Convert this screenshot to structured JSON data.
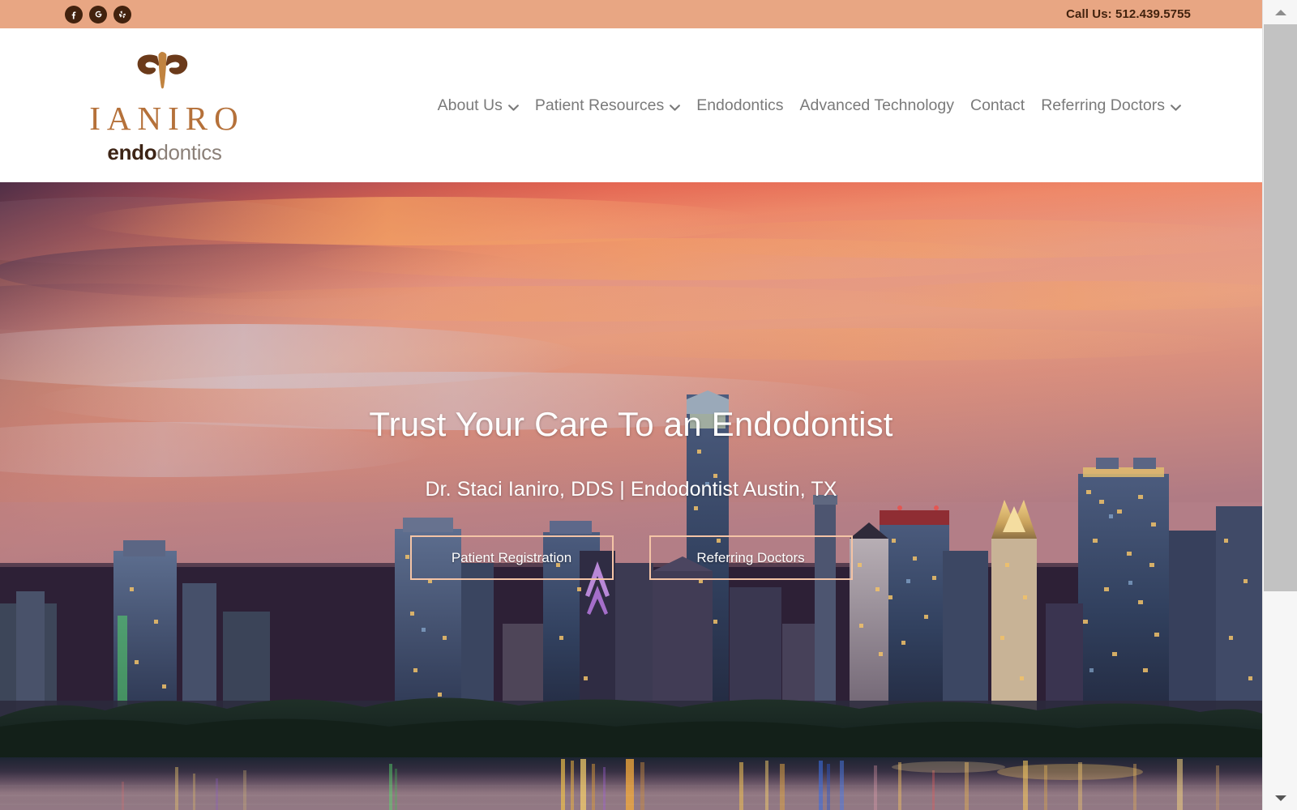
{
  "topbar": {
    "social": [
      {
        "name": "facebook-icon",
        "label": "Facebook"
      },
      {
        "name": "google-icon",
        "label": "Google"
      },
      {
        "name": "yelp-icon",
        "label": "Yelp"
      }
    ],
    "call_us": "Call Us: 512.439.5755",
    "background_color": "#e8a683",
    "icon_color": "#42220e"
  },
  "header": {
    "logo": {
      "wordmark": "IANIRO",
      "sub_bold": "endo",
      "sub_light": "dontics",
      "emblem_name": "ianiro-butterfly-tooth-emblem",
      "wordmark_color": "#b5713a",
      "sub_bold_color": "#3d2415",
      "sub_light_color": "#8b8078"
    },
    "nav": [
      {
        "label": "About Us",
        "has_dropdown": true
      },
      {
        "label": "Patient Resources",
        "has_dropdown": true
      },
      {
        "label": "Endodontics",
        "has_dropdown": false
      },
      {
        "label": "Advanced Technology",
        "has_dropdown": false
      },
      {
        "label": "Contact",
        "has_dropdown": false
      },
      {
        "label": "Referring Doctors",
        "has_dropdown": true
      }
    ],
    "nav_color": "#7a7a7a"
  },
  "hero": {
    "title": "Trust Your Care To an Endodontist",
    "subtitle": "Dr. Staci Ianiro, DDS | Endodontist Austin, TX",
    "buttons": [
      {
        "label": "Patient Registration"
      },
      {
        "label": "Referring Doctors"
      }
    ],
    "button_border_color": "#f4c4a6",
    "image_description": "Austin TX skyline at sunset reflected in Lady Bird Lake"
  },
  "scrollbar": {
    "up_arrow": "scroll-up-arrow",
    "down_arrow": "scroll-down-arrow",
    "thumb": "scroll-thumb"
  }
}
